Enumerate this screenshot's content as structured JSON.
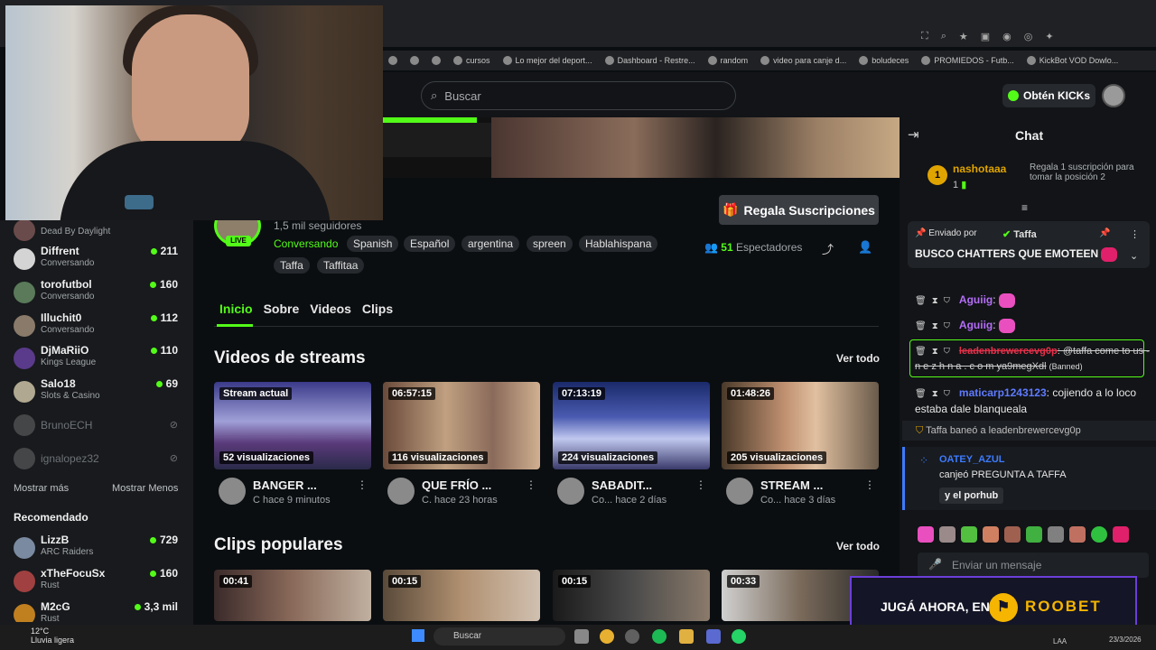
{
  "browser": {
    "bookmarks": [
      "cursos",
      "Lo mejor del deport...",
      "Dashboard - Restre...",
      "random",
      "video para canje d...",
      "boludeces",
      "PROMIEDOS - Futb...",
      "KickBot VOD Dowlo..."
    ]
  },
  "header": {
    "search_placeholder": "Buscar",
    "kicks_button": "Obtén KICKs"
  },
  "sidebar": {
    "following": [
      {
        "name": "",
        "category": "Dead By Daylight",
        "viewers": ""
      },
      {
        "name": "Diffrent",
        "category": "Conversando",
        "viewers": "211"
      },
      {
        "name": "torofutbol",
        "category": "Conversando",
        "viewers": "160"
      },
      {
        "name": "Illuchit0",
        "category": "Conversando",
        "viewers": "112"
      },
      {
        "name": "DjMaRiiO",
        "category": "Kings League",
        "viewers": "110"
      },
      {
        "name": "Salo18",
        "category": "Slots & Casino",
        "viewers": "69"
      }
    ],
    "offline": [
      {
        "name": "BrunoECH"
      },
      {
        "name": "ignalopez32"
      }
    ],
    "show_more": "Mostrar más",
    "show_less": "Mostrar Menos",
    "recommended_title": "Recomendado",
    "recommended": [
      {
        "name": "LizzB",
        "category": "ARC Raiders",
        "viewers": "729"
      },
      {
        "name": "xTheFocuSx",
        "category": "Rust",
        "viewers": "160"
      },
      {
        "name": "M2cG",
        "category": "Rust",
        "viewers": "3,3 mil"
      }
    ]
  },
  "channel": {
    "live_badge": "LIVE",
    "followers": "1,5 mil seguidores",
    "category": "Conversando",
    "tags": [
      "Spanish",
      "Español",
      "argentina",
      "spreen",
      "Hablahispana",
      "Taffa",
      "Taffitaa"
    ],
    "gift_button": "Regala Suscripciones",
    "viewers_count": "51",
    "viewers_label": "Espectadores",
    "tabs": [
      "Inicio",
      "Sobre",
      "Videos",
      "Clips"
    ]
  },
  "videos_section": {
    "title": "Videos de streams",
    "see_all": "Ver todo",
    "items": [
      {
        "duration": "Stream actual",
        "views": "52 visualizaciones",
        "title": "BANGER ...",
        "meta": "C  hace 9 minutos"
      },
      {
        "duration": "06:57:15",
        "views": "116 visualizaciones",
        "title": "QUE FRÍO ...",
        "meta": "C.  hace 23 horas"
      },
      {
        "duration": "07:13:19",
        "views": "224 visualizaciones",
        "title": "SABADIT...",
        "meta": "Co...  hace 2 días"
      },
      {
        "duration": "01:48:26",
        "views": "205 visualizaciones",
        "title": "STREAM ...",
        "meta": "Co...  hace 3 días"
      }
    ]
  },
  "clips_section": {
    "title": "Clips populares",
    "see_all": "Ver todo",
    "items": [
      {
        "duration": "00:41"
      },
      {
        "duration": "00:15"
      },
      {
        "duration": "00:15"
      },
      {
        "duration": "00:33"
      }
    ]
  },
  "chat": {
    "title": "Chat",
    "sub_gift": {
      "rank": "1",
      "user": "nashotaaa",
      "count": "1",
      "text": "Regala 1 suscripción para tomar la posición 2"
    },
    "pinned": {
      "sent_by": "Enviado por",
      "user": "Taffa",
      "message": "BUSCO CHATTERS QUE EMOTEEN"
    },
    "messages": [
      {
        "user": "Aguiig",
        "text": ""
      },
      {
        "user": "Aguiig",
        "text": ""
      },
      {
        "user": "leadenbrewercevg0p",
        "text": ": @taffa come to us - n e z h n a . c o m ya9megXdl",
        "status": "(Banned)"
      },
      {
        "user": "maticarp1243123",
        "text": ": cojiendo a lo loco estaba dale blanqueala"
      }
    ],
    "ban_notice": "Taffa baneó a leadenbrewercevg0p",
    "redeem": {
      "user": "OATEY_AZUL",
      "text": "canjeó PREGUNTA A TAFFA",
      "input": "y el porhub"
    },
    "input_placeholder": "Enviar un mensaje"
  },
  "ad": {
    "text": "JUGÁ AHORA, EN",
    "brand": "ROOBET"
  },
  "taskbar": {
    "temp": "12°C",
    "weather": "Lluvia ligera",
    "search": "Buscar",
    "lang": "LAA",
    "date": "23/3/2026"
  }
}
